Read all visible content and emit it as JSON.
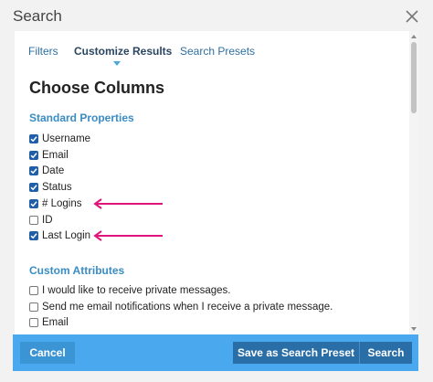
{
  "dialog": {
    "title": "Search"
  },
  "tabs": [
    {
      "label": "Filters",
      "active": false
    },
    {
      "label": "Customize Results",
      "active": true
    },
    {
      "label": "Search Presets",
      "active": false
    }
  ],
  "content": {
    "heading": "Choose Columns",
    "standard": {
      "heading": "Standard Properties",
      "items": [
        {
          "label": "Username",
          "checked": true
        },
        {
          "label": "Email",
          "checked": true
        },
        {
          "label": "Date",
          "checked": true
        },
        {
          "label": "Status",
          "checked": true
        },
        {
          "label": "# Logins",
          "checked": true,
          "highlighted": true
        },
        {
          "label": "ID",
          "checked": false
        },
        {
          "label": "Last Login",
          "checked": true,
          "highlighted": true
        }
      ]
    },
    "custom": {
      "heading": "Custom Attributes",
      "items": [
        {
          "label": "I would like to receive private messages.",
          "checked": false
        },
        {
          "label": "Send me email notifications when I receive a private message.",
          "checked": false
        },
        {
          "label": "Email",
          "checked": false
        }
      ]
    }
  },
  "footer": {
    "cancel_label": "Cancel",
    "save_preset_label": "Save as Search Preset",
    "search_label": "Search"
  },
  "colors": {
    "accent": "#4aa8ee",
    "arrow": "#e0147a",
    "link": "#2f6fa0"
  },
  "icons": {
    "close": "close-icon",
    "check": "checkmark-icon",
    "arrow": "arrow-left-icon"
  }
}
